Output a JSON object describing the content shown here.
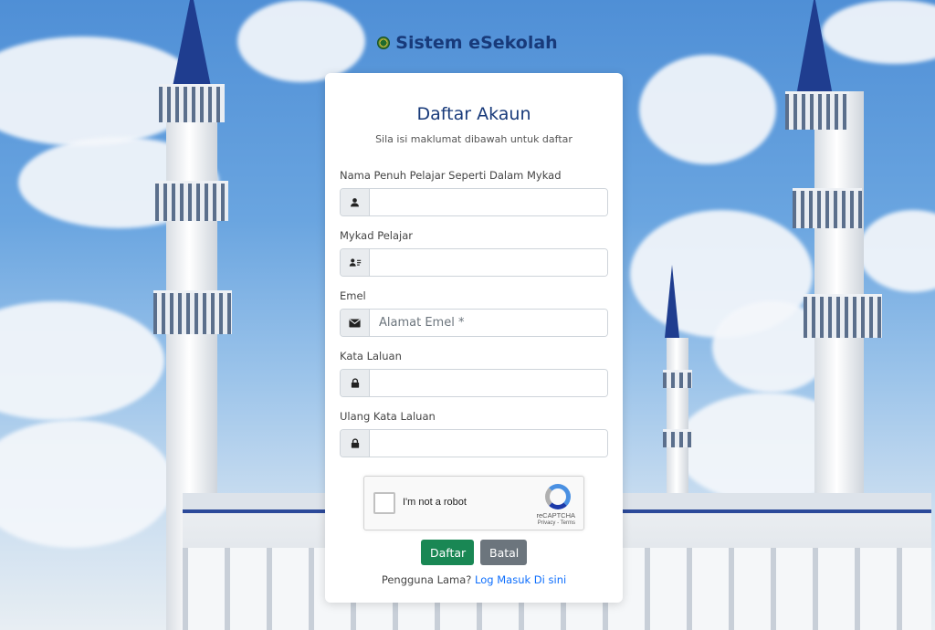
{
  "brand": {
    "title": "Sistem eSekolah",
    "logo_icon": "school-crest-icon"
  },
  "card": {
    "title": "Daftar Akaun",
    "subtitle": "Sila isi maklumat dibawah untuk daftar"
  },
  "form": {
    "fields": [
      {
        "label": "Nama Penuh Pelajar Seperti Dalam Mykad",
        "icon": "user-icon",
        "value": "",
        "placeholder": ""
      },
      {
        "label": "Mykad Pelajar",
        "icon": "id-card-icon",
        "value": "",
        "placeholder": ""
      },
      {
        "label": "Emel",
        "icon": "envelope-icon",
        "value": "",
        "placeholder": "Alamat Emel *"
      },
      {
        "label": "Kata Laluan",
        "icon": "lock-icon",
        "value": "",
        "placeholder": ""
      },
      {
        "label": "Ulang Kata Laluan",
        "icon": "lock-icon",
        "value": "",
        "placeholder": ""
      }
    ]
  },
  "recaptcha": {
    "label": "I'm not a robot",
    "brand": "reCAPTCHA",
    "terms": "Privacy - Terms"
  },
  "actions": {
    "submit_label": "Daftar",
    "cancel_label": "Batal"
  },
  "footer": {
    "prompt": "Pengguna Lama?",
    "login_link": "Log Masuk Di sini"
  },
  "colors": {
    "brand": "#183a7a",
    "primary": "#198754",
    "secondary": "#6c757d",
    "link": "#0d6efd"
  }
}
